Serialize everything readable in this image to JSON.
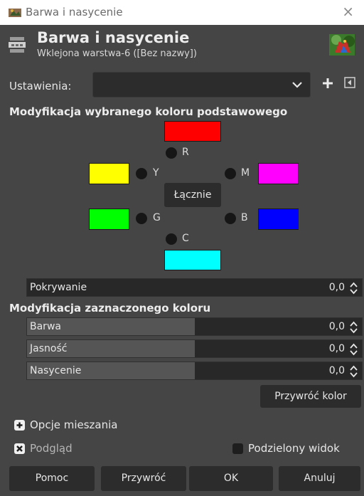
{
  "window": {
    "title": "Barwa i nasycenie",
    "close_glyph": "×"
  },
  "header": {
    "title": "Barwa i nasycenie",
    "subtitle": "Wklejona warstwa-6 ([Bez nazwy])"
  },
  "settings": {
    "label": "Ustawienia:",
    "value": ""
  },
  "primary": {
    "heading": "Modyfikacja wybranego koloru podstawowego",
    "colors": {
      "R": {
        "label": "R",
        "hex": "#ff0000"
      },
      "Y": {
        "label": "Y",
        "hex": "#ffff00"
      },
      "M": {
        "label": "M",
        "hex": "#ff00ff"
      },
      "G": {
        "label": "G",
        "hex": "#00ff00"
      },
      "B": {
        "label": "B",
        "hex": "#0000ff"
      },
      "C": {
        "label": "C",
        "hex": "#00ffff"
      }
    },
    "master_button": "Łącznie"
  },
  "overlap": {
    "label": "Pokrywanie",
    "value": "0,0"
  },
  "selected": {
    "heading": "Modyfikacja zaznaczonego koloru",
    "hue": {
      "label": "Barwa",
      "value": "0,0"
    },
    "lightness": {
      "label": "Jasność",
      "value": "0,0"
    },
    "saturation": {
      "label": "Nasycenie",
      "value": "0,0"
    },
    "reset_color_button": "Przywróć kolor"
  },
  "blend_options": {
    "label": "Opcje mieszania"
  },
  "preview": {
    "label": "Podgląd",
    "checked": true
  },
  "split_view": {
    "label": "Podzielony widok",
    "checked": false
  },
  "buttons": {
    "help": "Pomoc",
    "reset": "Przywróć",
    "ok": "OK",
    "cancel": "Anuluj"
  },
  "colors": {
    "dialog_bg": "#454545",
    "field_bg": "#2c2c2c",
    "slider_fill": "#555555"
  }
}
